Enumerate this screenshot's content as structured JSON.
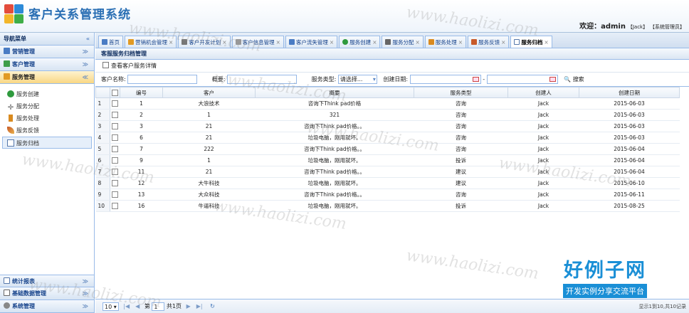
{
  "app": {
    "title": "客户关系管理系统",
    "welcome_label": "欢迎：",
    "user": "admin",
    "user_tag": "【Jack】",
    "role_tag": "【系统管理员】"
  },
  "sidebar": {
    "heading": "导航菜单",
    "collapse_icon": "«",
    "panels": [
      {
        "label": "营销管理",
        "icon": "chart-icon",
        "color": "#4a7cc4"
      },
      {
        "label": "客户管理",
        "icon": "users-icon",
        "color": "#3d9d4a"
      },
      {
        "label": "服务管理",
        "icon": "service-icon",
        "color": "#e19a23"
      }
    ],
    "items": [
      {
        "label": "服务创建",
        "icon": "plus-circle-icon",
        "color": "#2f9a3e"
      },
      {
        "label": "服务分配",
        "icon": "cross-arrows-icon",
        "color": "#666666"
      },
      {
        "label": "服务处理",
        "icon": "bottle-icon",
        "color": "#d98a1f"
      },
      {
        "label": "服务反馈",
        "icon": "feather-icon",
        "color": "#c85a2a"
      },
      {
        "label": "服务归档",
        "icon": "document-icon",
        "color": "#5577aa"
      }
    ],
    "bottom_panels": [
      {
        "label": "统计报表",
        "icon": "report-icon",
        "color": "#5577aa"
      },
      {
        "label": "基础数据管理",
        "icon": "database-icon",
        "color": "#666666"
      },
      {
        "label": "系统管理",
        "icon": "system-icon",
        "color": "#888888"
      }
    ]
  },
  "tabs": [
    {
      "label": "首页",
      "closable": false,
      "color": "#4a7cc4"
    },
    {
      "label": "营销机会管理",
      "closable": true,
      "color": "#e19a23"
    },
    {
      "label": "客户开发计划",
      "closable": true,
      "color": "#777777"
    },
    {
      "label": "客户信息管理",
      "closable": true,
      "color": "#999999"
    },
    {
      "label": "客户流失管理",
      "closable": true,
      "color": "#4a7cc4"
    },
    {
      "label": "服务创建",
      "closable": true,
      "color": "#2f9a3e"
    },
    {
      "label": "服务分配",
      "closable": true,
      "color": "#666666"
    },
    {
      "label": "服务处理",
      "closable": true,
      "color": "#d98a1f"
    },
    {
      "label": "服务反馈",
      "closable": true,
      "color": "#c85a2a"
    },
    {
      "label": "服务归档",
      "closable": true,
      "color": "#5577aa",
      "active": true
    }
  ],
  "page": {
    "breadcrumb": "客服服务归档管理",
    "toolbar_action": "查看客户服务详情"
  },
  "filter": {
    "customer_label": "客户名称:",
    "customer_value": "",
    "summary_label": "概要:",
    "summary_value": "",
    "type_label": "服务类型:",
    "type_value": "请选择...",
    "date_label": "创建日期:",
    "date_sep": "-",
    "search_label": "搜索"
  },
  "grid": {
    "columns": [
      "编号",
      "客户",
      "概要",
      "服务类型",
      "创建人",
      "创建日期"
    ],
    "rows": [
      [
        "1",
        "大浪技术",
        "咨询下Think pad价格",
        "咨询",
        "Jack",
        "2015-06-03"
      ],
      [
        "2",
        "1",
        "321",
        "咨询",
        "Jack",
        "2015-06-03"
      ],
      [
        "3",
        "21",
        "咨询下Think pad价格。。",
        "咨询",
        "Jack",
        "2015-06-03"
      ],
      [
        "6",
        "21",
        "垃圾电脑，刚用就坏。",
        "咨询",
        "Jack",
        "2015-06-03"
      ],
      [
        "7",
        "222",
        "咨询下Think pad价格。。",
        "咨询",
        "Jack",
        "2015-06-04"
      ],
      [
        "9",
        "1",
        "垃圾电脑，刚用就坏。",
        "投诉",
        "Jack",
        "2015-06-04"
      ],
      [
        "11",
        "21",
        "咨询下Think pad价格。。",
        "建议",
        "Jack",
        "2015-06-04"
      ],
      [
        "12",
        "大牛科技",
        "垃圾电脑，刚用就坏。",
        "建议",
        "Jack",
        "2015-06-10"
      ],
      [
        "13",
        "大众科技",
        "咨询下Think pad价格。。",
        "咨询",
        "Jack",
        "2015-06-11"
      ],
      [
        "16",
        "牛逼科技",
        "垃圾电脑，刚用就坏。",
        "投诉",
        "Jack",
        "2015-08-25"
      ]
    ]
  },
  "pager": {
    "page_size": "10",
    "page_prefix": "第",
    "page_value": "1",
    "page_suffix": "共1页",
    "info": "显示1到10,共10记录"
  },
  "watermark": {
    "site": "www.haolizi.com",
    "brand_title": "好例子网",
    "brand_subtitle": "开发实例分享交流平台"
  }
}
